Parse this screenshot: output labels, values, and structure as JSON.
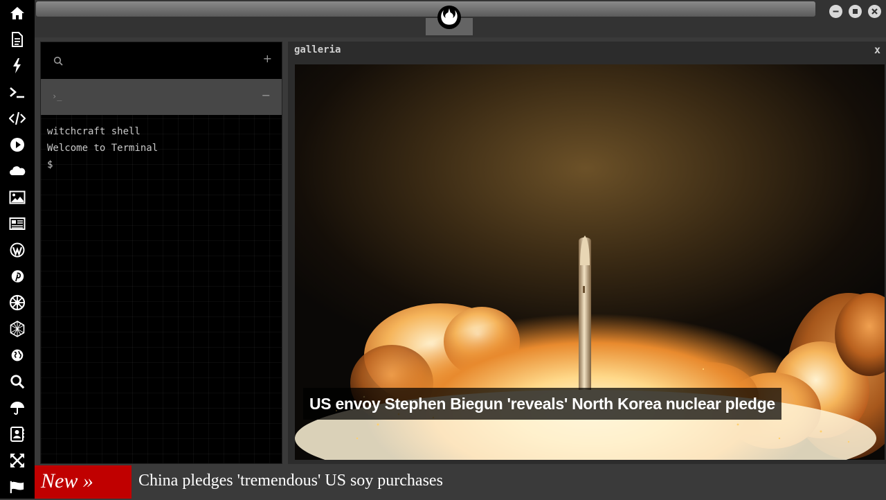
{
  "sidebar": {
    "items": [
      {
        "icon": "home-icon"
      },
      {
        "icon": "document-icon"
      },
      {
        "icon": "lightning-icon"
      },
      {
        "icon": "terminal-icon"
      },
      {
        "icon": "code-icon"
      },
      {
        "icon": "play-icon"
      },
      {
        "icon": "cloud-icon"
      },
      {
        "icon": "image-icon"
      },
      {
        "icon": "newspaper-icon"
      },
      {
        "icon": "wordpress-icon"
      },
      {
        "icon": "pinterest-icon"
      },
      {
        "icon": "empire-icon"
      },
      {
        "icon": "geometric-sphere-icon"
      },
      {
        "icon": "globe-icon"
      },
      {
        "icon": "search-icon"
      },
      {
        "icon": "umbrella-icon"
      },
      {
        "icon": "contact-card-icon"
      },
      {
        "icon": "expand-icon"
      },
      {
        "icon": "flag-icon"
      }
    ]
  },
  "topbar": {
    "logo_icon": "rebel-alliance-icon",
    "window_controls": [
      "minimize-icon",
      "maximize-icon",
      "close-icon"
    ]
  },
  "terminal": {
    "search_icon": "search-icon",
    "add_label": "+",
    "prompt_label": "›_",
    "collapse_label": "−",
    "lines": [
      "witchcraft shell",
      "Welcome to Terminal",
      "$"
    ]
  },
  "gallery": {
    "title": "galleria",
    "close_label": "x",
    "caption": "US envoy Stephen Biegun 'reveals' North Korea nuclear pledge"
  },
  "ticker": {
    "badge": "New »",
    "headline": "China pledges 'tremendous' US soy purchases"
  },
  "colors": {
    "sidebar_bg": "#000000",
    "ticker_badge": "#c00000",
    "panel_bg": "#2c2c2c"
  }
}
